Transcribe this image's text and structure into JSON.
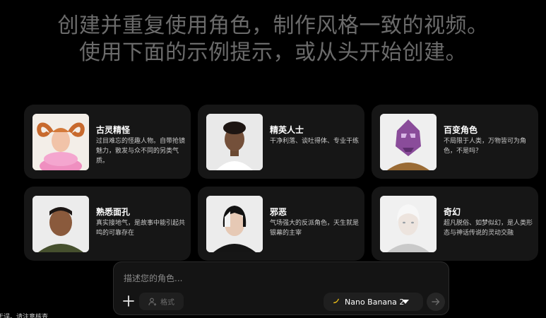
{
  "hero": {
    "line1": "创建并重复使用角色，制作风格一致的视频。",
    "line2": "使用下面的示例提示，或从头开始创建。"
  },
  "cards": [
    {
      "title": "古灵精怪",
      "desc": "过目难忘的怪趣人物。自带抢镜魅力，散发与众不同的另类气质。"
    },
    {
      "title": "精英人士",
      "desc": "干净利落、谈吐得体、专业干练"
    },
    {
      "title": "百变角色",
      "desc": "不局限于人类，万物皆可为角色，不是吗？"
    },
    {
      "title": "熟悉面孔",
      "desc": "真实接地气，是故事中能引起共鸣的可靠存在"
    },
    {
      "title": "邪恶",
      "desc": "气场强大的反派角色，天生就是银幕的主宰"
    },
    {
      "title": "奇幻",
      "desc": "超凡脱俗、如梦似幻，是人类形态与神话传说的灵动交融"
    }
  ],
  "composer": {
    "placeholder": "描述您的角色...",
    "format_label": "格式",
    "model_label": "Nano Banana 2"
  },
  "bottom_note": "无误。请注意核查",
  "icons": {
    "add": "plus-icon",
    "format": "person-add-icon",
    "model": "banana-icon",
    "dropdown": "caret-down-icon",
    "send": "arrow-right-icon"
  }
}
